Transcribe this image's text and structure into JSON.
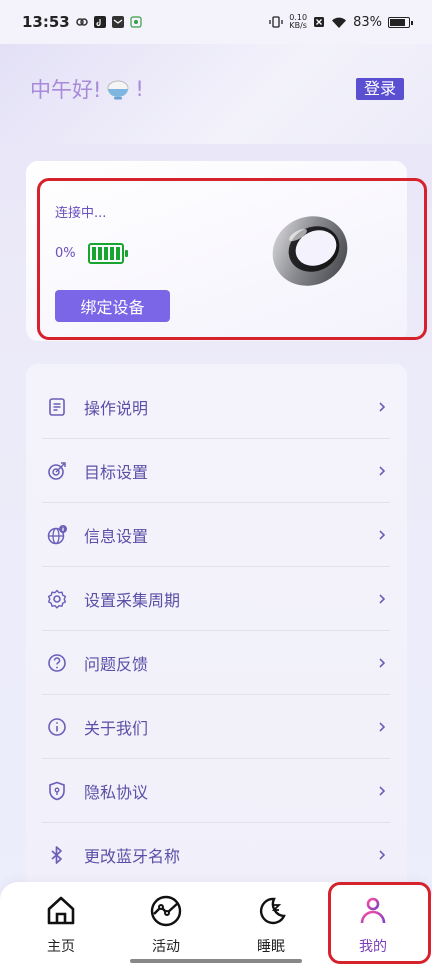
{
  "status_bar": {
    "time": "13:53",
    "net_speed_value": "0.10",
    "net_speed_unit": "KB/s",
    "battery_pct": "83%"
  },
  "header": {
    "greeting": "中午好!",
    "greeting_suffix": "!",
    "login_label": "登录"
  },
  "device": {
    "status": "连接中...",
    "battery_percent": "0%",
    "battery_level": 1.0,
    "bind_label": "绑定设备",
    "battery_color": "#18a52f"
  },
  "menu": {
    "items": [
      {
        "label": "操作说明",
        "icon": "document-icon"
      },
      {
        "label": "目标设置",
        "icon": "target-icon"
      },
      {
        "label": "信息设置",
        "icon": "globe-info-icon"
      },
      {
        "label": "设置采集周期",
        "icon": "gear-icon"
      },
      {
        "label": "问题反馈",
        "icon": "question-icon"
      },
      {
        "label": "关于我们",
        "icon": "info-icon"
      },
      {
        "label": "隐私协议",
        "icon": "shield-icon"
      },
      {
        "label": "更改蓝牙名称",
        "icon": "bluetooth-icon"
      }
    ]
  },
  "nav": {
    "items": [
      {
        "label": "主页",
        "icon": "home-icon"
      },
      {
        "label": "活动",
        "icon": "activity-icon"
      },
      {
        "label": "睡眠",
        "icon": "sleep-moon-icon"
      },
      {
        "label": "我的",
        "icon": "profile-icon",
        "active": true
      }
    ]
  },
  "colors": {
    "accent": "#7b66e8",
    "login_bg": "#5b4fd1",
    "menu_text": "#5b4fa8",
    "highlight": "#d6222c"
  }
}
